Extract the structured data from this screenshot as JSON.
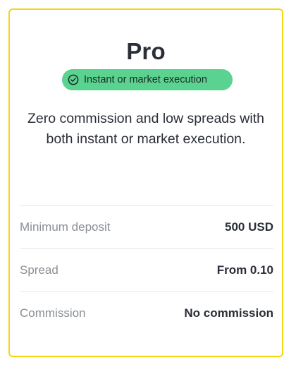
{
  "plan": {
    "title": "Pro",
    "badge": {
      "icon": "check-circle-icon",
      "label": "Instant or market execution",
      "color": "#5ad290"
    },
    "description_line1": "Zero commission and low spreads with",
    "description_line2": "both instant or market execution.",
    "specs": [
      {
        "label": "Minimum deposit",
        "value": "500 USD"
      },
      {
        "label": "Spread",
        "value": "From 0.10"
      },
      {
        "label": "Commission",
        "value": "No commission"
      }
    ]
  },
  "colors": {
    "card_border": "#f5d60f",
    "text_primary": "#2a2e36",
    "text_muted": "#8a8f95"
  }
}
